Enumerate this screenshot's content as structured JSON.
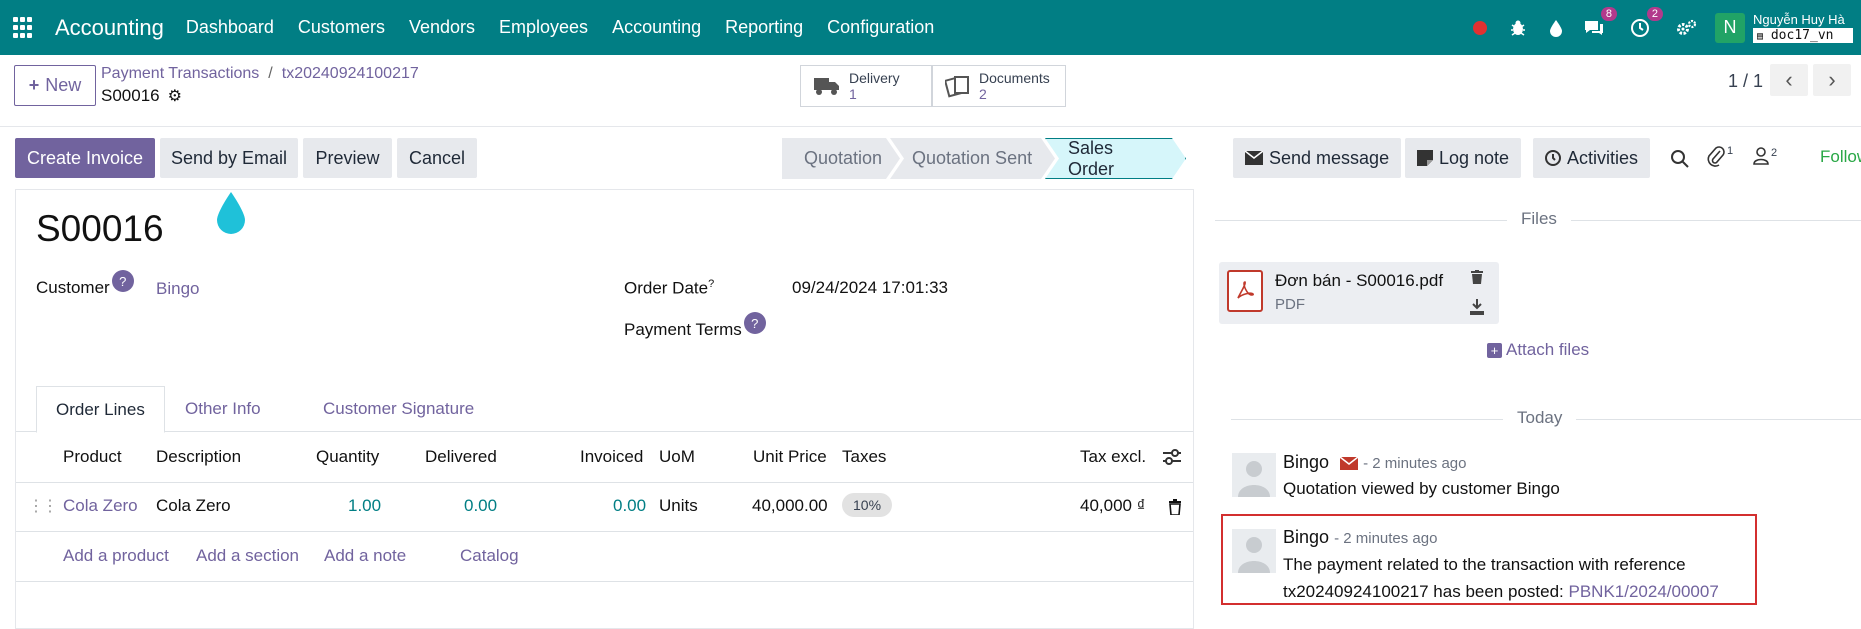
{
  "topbar": {
    "brand": "Accounting",
    "menu": [
      "Dashboard",
      "Customers",
      "Vendors",
      "Employees",
      "Accounting",
      "Reporting",
      "Configuration"
    ],
    "messages_count": "8",
    "activities_count": "2",
    "user_initial": "N",
    "user_name": "Nguyễn Huy Hà",
    "db_name": "doc17_vn"
  },
  "control_panel": {
    "new_label": "New",
    "breadcrumb": [
      "Payment Transactions",
      "tx20240924100217"
    ],
    "record_name": "S00016",
    "smart_buttons": [
      {
        "label": "Delivery",
        "count": "1"
      },
      {
        "label": "Documents",
        "count": "2"
      }
    ],
    "pager": "1 / 1"
  },
  "actions": {
    "create_invoice": "Create Invoice",
    "send_by_email": "Send by Email",
    "preview": "Preview",
    "cancel": "Cancel"
  },
  "statusbar": [
    "Quotation",
    "Quotation Sent",
    "Sales Order"
  ],
  "form": {
    "title": "S00016",
    "customer_label": "Customer",
    "customer_value": "Bingo",
    "order_date_label": "Order Date",
    "order_date_sup": "?",
    "order_date_value": "09/24/2024 17:01:33",
    "payment_terms_label": "Payment Terms",
    "help_glyph": "?",
    "tabs": [
      "Order Lines",
      "Other Info",
      "Customer Signature"
    ],
    "columns": [
      "Product",
      "Description",
      "Quantity",
      "Delivered",
      "Invoiced",
      "UoM",
      "Unit Price",
      "Taxes",
      "Tax excl."
    ],
    "line": {
      "product": "Cola Zero",
      "description": "Cola Zero",
      "quantity": "1.00",
      "delivered": "0.00",
      "invoiced": "0.00",
      "uom": "Units",
      "unit_price": "40,000.00",
      "tax": "10%",
      "subtotal": "40,000 ₫"
    },
    "add_links": [
      "Add a product",
      "Add a section",
      "Add a note",
      "Catalog"
    ]
  },
  "chatter": {
    "send_message": "Send message",
    "log_note": "Log note",
    "activities": "Activities",
    "attachments_count": "1",
    "followers_count": "2",
    "follow_label": "Follow",
    "files_title": "Files",
    "attachment_name": "Đơn bán - S00016.pdf",
    "attachment_type": "PDF",
    "attach_files": "Attach files",
    "today_label": "Today",
    "messages": [
      {
        "author": "Bingo",
        "time": "- 2 minutes ago",
        "body": "Quotation viewed by customer Bingo"
      },
      {
        "author": "Bingo",
        "time": "- 2 minutes ago",
        "body_line1": "The payment related to the transaction with reference",
        "body_line2_prefix": "tx20240924100217 has been posted: ",
        "body_link": "PBNK1/2024/00007"
      }
    ]
  },
  "colors": {
    "topbar": "#017e84",
    "primary": "#71639e",
    "highlight_border": "#d32f2f"
  }
}
